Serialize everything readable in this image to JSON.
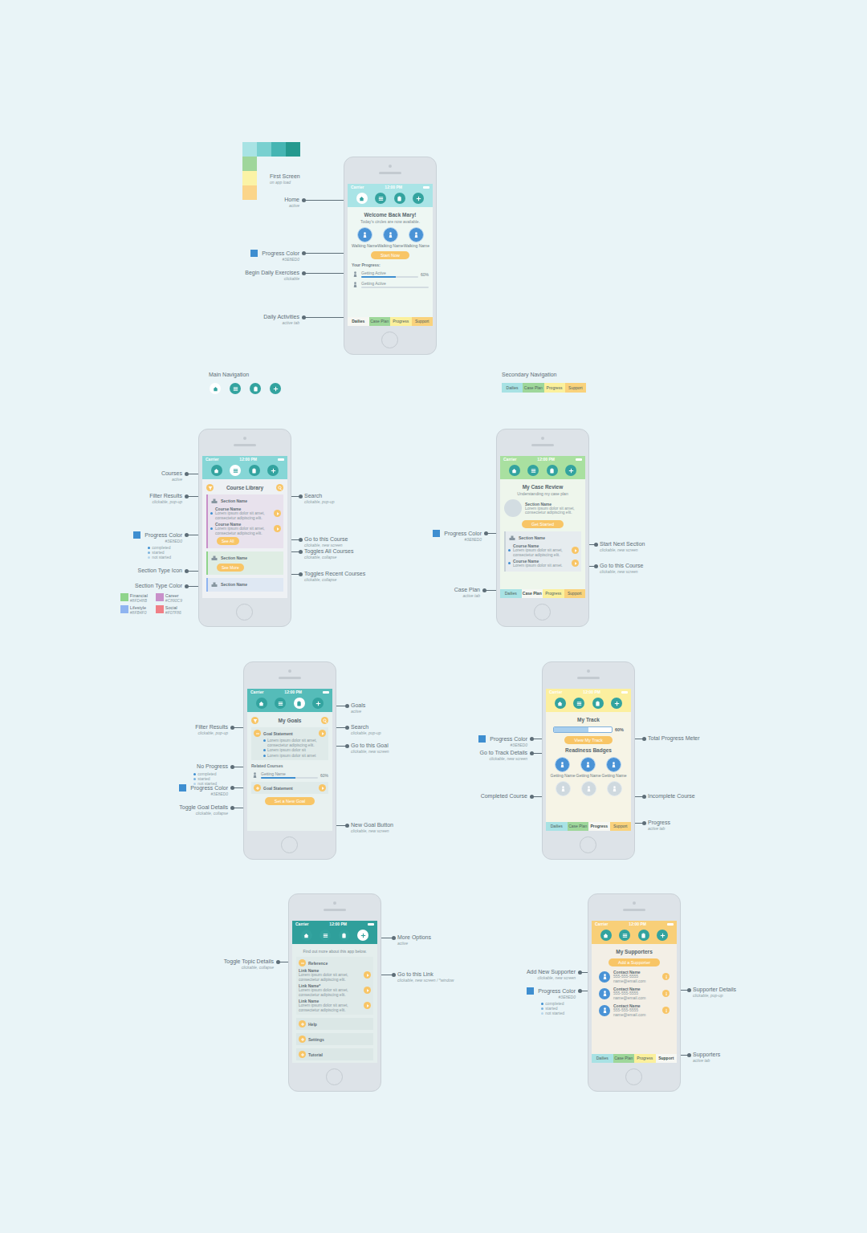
{
  "title": {
    "label": "First Screen",
    "note": "on app load"
  },
  "palette": [
    {
      "color": "#a8e3e4"
    },
    {
      "color": "#79d0d0"
    },
    {
      "color": "#46b5b3"
    },
    {
      "color": "#25998f"
    },
    {
      "color": "#9fd69b"
    },
    {
      "color": "#fbf3a6"
    },
    {
      "color": "#fbd58a"
    }
  ],
  "main_navigation": {
    "label": "Main Navigation",
    "items": [
      {
        "selected": true
      },
      {
        "selected": false
      },
      {
        "selected": false
      },
      {
        "selected": false
      }
    ]
  },
  "secondary_navigation": {
    "label": "Secondary Navigation",
    "tabs": [
      {
        "label": "Dailies",
        "color": "#a8e2e4"
      },
      {
        "label": "Case Plan",
        "color": "#9ed79a"
      },
      {
        "label": "Progress",
        "color": "#fbf09c"
      },
      {
        "label": "Support",
        "color": "#f9d27c"
      }
    ]
  },
  "phones": [
    {
      "status": {
        "carrier": "Carrier",
        "time": "12:00 PM"
      },
      "nav": [
        {
          "selected": true
        },
        {
          "selected": false
        },
        {
          "selected": false
        },
        {
          "selected": false
        }
      ],
      "blocks": [
        {
          "kind": "title",
          "text": "Welcome Back Mary!"
        },
        {
          "kind": "subtitle",
          "text": "Today's circles are now available."
        },
        {
          "kind": "circles",
          "items": [
            {
              "label": "Walking Name",
              "completed": true
            },
            {
              "label": "Walking Name",
              "completed": true
            },
            {
              "label": "Walking Name",
              "completed": true
            }
          ]
        },
        {
          "kind": "button",
          "text": "Start Now"
        },
        {
          "kind": "label",
          "text": "Your Progress:"
        },
        {
          "kind": "progress",
          "name": "Getting Active",
          "level": 0.6,
          "reading": "60%"
        },
        {
          "kind": "progress",
          "name": "Getting Active",
          "level": 0
        }
      ],
      "tabs": [
        {
          "label": "Dailies",
          "selected": true,
          "color": "#a8e2e4"
        },
        {
          "label": "Case Plan",
          "selected": false,
          "color": "#9ed79a"
        },
        {
          "label": "Progress",
          "selected": false,
          "color": "#fbf09c"
        },
        {
          "label": "Support",
          "selected": false,
          "color": "#f9d27c"
        }
      ],
      "annotations": [
        {
          "label": "Home",
          "note": "active"
        },
        {
          "label": "Progress Color",
          "note": "#3E8ED0",
          "swatch": "#3e8ed0"
        },
        {
          "label": "Begin Daily Exercises",
          "note": "clickable"
        },
        {
          "label": "Daily Activities",
          "note": "active tab"
        }
      ]
    },
    {
      "status": {
        "carrier": "Carrier",
        "time": "12:00 PM"
      },
      "nav": [
        {
          "selected": false
        },
        {
          "selected": true
        },
        {
          "selected": false
        },
        {
          "selected": false
        }
      ],
      "blocks": [
        {
          "kind": "toolbar",
          "title": "Course Library"
        },
        {
          "kind": "section",
          "name": "Section Name",
          "color": "#c890c9",
          "items": [
            {
              "name": "Course Name",
              "text": "Lorem ipsum dolor sit amet, consectetur adipiscing elit."
            },
            {
              "name": "Course Name",
              "text": "Lorem ipsum dolor sit amet, consectetur adipiscing elit."
            }
          ],
          "button": "See All"
        },
        {
          "kind": "section",
          "name": "Section Name",
          "color": "#8fd48b",
          "items": [],
          "button": "See More"
        },
        {
          "kind": "section",
          "name": "Section Name",
          "color": "#8fb4f0",
          "items": []
        }
      ],
      "annotations": [
        {
          "label": "Courses",
          "note": "active"
        },
        {
          "label": "Filter Results",
          "note": "clickable, pop-up"
        },
        {
          "label": "Progress Color",
          "note": "#3E8ED0",
          "swatch": "#3e8ed0",
          "bullets": [
            "completed",
            "started",
            "not started"
          ]
        },
        {
          "label": "Section Type Icon"
        },
        {
          "label": "Section Type Color",
          "legend": [
            {
              "label": "Financial",
              "note": "#8FD48B",
              "color": "#8fd48b"
            },
            {
              "label": "Career",
              "note": "#C890C9",
              "color": "#c890c9"
            },
            {
              "label": "Lifestyle",
              "note": "#8FB4F0",
              "color": "#8fb4f0"
            },
            {
              "label": "Social",
              "note": "#F07F86",
              "color": "#f07f86"
            }
          ]
        },
        {
          "label": "Search",
          "note": "clickable, pop-up"
        },
        {
          "label": "Go to this Course",
          "note": "clickable, new screen"
        },
        {
          "label": "Toggles All Courses",
          "note": "clickable, collapse"
        },
        {
          "label": "Toggles Recent Courses",
          "note": "clickable, collapse"
        }
      ]
    },
    {
      "status": {
        "carrier": "Carrier",
        "time": "12:00 PM"
      },
      "nav": [
        {
          "selected": false
        },
        {
          "selected": false
        },
        {
          "selected": false
        },
        {
          "selected": false
        }
      ],
      "blocks": [
        {
          "kind": "title",
          "text": "My Case Review"
        },
        {
          "kind": "subtitle",
          "text": "Understanding my case plan"
        },
        {
          "kind": "feature",
          "name": "Section Name",
          "text": "Lorem ipsum dolor sit amet, consectetur adipiscing elit."
        },
        {
          "kind": "button",
          "text": "Get Started"
        },
        {
          "kind": "section",
          "name": "Section Name",
          "items": [
            {
              "name": "Course Name",
              "text": "Lorem ipsum dolor sit amet, consectetur adipiscing elit."
            },
            {
              "name": "Course Name",
              "text": "Lorem ipsum dolor sit amet."
            }
          ]
        }
      ],
      "tabs": [
        {
          "label": "Dailies",
          "selected": false,
          "color": "#a8e2e4"
        },
        {
          "label": "Case Plan",
          "selected": true,
          "color": "#9ed79a"
        },
        {
          "label": "Progress",
          "selected": false,
          "color": "#fbf09c"
        },
        {
          "label": "Support",
          "selected": false,
          "color": "#f9d27c"
        }
      ],
      "annotations": [
        {
          "label": "Progress Color",
          "note": "#3E8ED0",
          "swatch": "#3e8ed0"
        },
        {
          "label": "Case Plan",
          "note": "active tab"
        },
        {
          "label": "Start Next Section",
          "note": "clickable, new screen"
        },
        {
          "label": "Go to this Course",
          "note": "clickable, new screen"
        }
      ]
    },
    {
      "status": {
        "carrier": "Carrier",
        "time": "12:00 PM"
      },
      "nav": [
        {
          "selected": false
        },
        {
          "selected": false
        },
        {
          "selected": true
        },
        {
          "selected": false
        }
      ],
      "blocks": [
        {
          "kind": "toolbar",
          "title": "My Goals"
        },
        {
          "kind": "goal",
          "name": "Goal Statement",
          "expanded": true,
          "bullets": [
            "Lorem ipsum dolor sit amet, consectetur adipiscing elit.",
            "Lorem ipsum dolor sit",
            "Lorem ipsum dolor sit amet"
          ]
        },
        {
          "kind": "label",
          "text": "Related Courses"
        },
        {
          "kind": "progress",
          "name": "Getting Name",
          "level": 0.6,
          "reading": "60%"
        },
        {
          "kind": "goal",
          "name": "Goal Statement",
          "expanded": false
        },
        {
          "kind": "button",
          "text": "Set a New Goal"
        }
      ],
      "annotations": [
        {
          "label": "Filter Results",
          "note": "clickable, pop-up"
        },
        {
          "label": "No Progress",
          "bullets": [
            "completed",
            "started",
            "not started"
          ]
        },
        {
          "label": "Progress Color",
          "note": "#3E8ED0",
          "swatch": "#3e8ed0"
        },
        {
          "label": "Toggle Goal Details",
          "note": "clickable, collapse"
        },
        {
          "label": "Goals",
          "note": "active"
        },
        {
          "label": "Search",
          "note": "clickable, pop-up"
        },
        {
          "label": "Go to this Goal",
          "note": "clickable, new screen"
        },
        {
          "label": "New Goal Button",
          "note": "clickable, new screen"
        }
      ]
    },
    {
      "status": {
        "carrier": "Carrier",
        "time": "12:00 PM"
      },
      "nav": [
        {
          "selected": false
        },
        {
          "selected": false
        },
        {
          "selected": false
        },
        {
          "selected": false
        }
      ],
      "blocks": [
        {
          "kind": "title",
          "text": "My Track"
        },
        {
          "kind": "meter",
          "level": 0.6,
          "reading": "60%"
        },
        {
          "kind": "button",
          "text": "View My Track"
        },
        {
          "kind": "title",
          "text": "Readiness Badges"
        },
        {
          "kind": "circles",
          "items": [
            {
              "label": "Getting Name",
              "completed": true
            },
            {
              "label": "Getting Name",
              "completed": true
            },
            {
              "label": "Getting Name",
              "completed": true
            }
          ]
        },
        {
          "kind": "circles",
          "items": [
            {
              "completed": false
            },
            {
              "completed": false
            },
            {
              "completed": false
            }
          ]
        }
      ],
      "tabs": [
        {
          "label": "Dailies",
          "selected": false,
          "color": "#a8e2e4"
        },
        {
          "label": "Case Plan",
          "selected": false,
          "color": "#9ed79a"
        },
        {
          "label": "Progress",
          "selected": true,
          "color": "#fbf09c"
        },
        {
          "label": "Support",
          "selected": false,
          "color": "#f9d27c"
        }
      ],
      "annotations": [
        {
          "label": "Progress Color",
          "note": "#3E8ED0",
          "swatch": "#3e8ed0"
        },
        {
          "label": "Go to Track Details",
          "note": "clickable, new screen"
        },
        {
          "label": "Completed Course"
        },
        {
          "label": "Total Progress Meter"
        },
        {
          "label": "Incomplete Course"
        },
        {
          "label": "Progress",
          "note": "active tab"
        }
      ]
    },
    {
      "status": {
        "carrier": "Carrier",
        "time": "12:00 PM"
      },
      "nav": [
        {
          "selected": false
        },
        {
          "selected": false
        },
        {
          "selected": false
        },
        {
          "selected": true
        }
      ],
      "blocks": [
        {
          "kind": "note",
          "text": "Find out more about this app below."
        },
        {
          "kind": "links",
          "name": "Reference",
          "items": [
            {
              "name": "Link Name",
              "text": "Lorem ipsum dolor sit amet, consectetur adipiscing elit."
            },
            {
              "name": "Link Name*",
              "text": "Lorem ipsum dolor sit amet, consectetur adipiscing elit."
            },
            {
              "name": "Link Name",
              "text": "Lorem ipsum dolor sit amet, consectetur adipiscing elit."
            }
          ]
        },
        {
          "kind": "menu",
          "text": "Help"
        },
        {
          "kind": "menu",
          "text": "Settings"
        },
        {
          "kind": "menu",
          "text": "Tutorial"
        }
      ],
      "annotations": [
        {
          "label": "Toggle Topic Details",
          "note": "clickable, collapse"
        },
        {
          "label": "More Options",
          "note": "active"
        },
        {
          "label": "Go to this Link",
          "note": "clickable, new screen / *window"
        }
      ]
    },
    {
      "status": {
        "carrier": "Carrier",
        "time": "12:00 PM"
      },
      "nav": [
        {
          "selected": false
        },
        {
          "selected": false
        },
        {
          "selected": false
        },
        {
          "selected": false
        }
      ],
      "blocks": [
        {
          "kind": "title",
          "text": "My Supporters"
        },
        {
          "kind": "button",
          "text": "Add a Supporter"
        },
        {
          "kind": "contact",
          "name": "Contact Name",
          "phone": "555-555-5555",
          "email": "name@email.com"
        },
        {
          "kind": "contact",
          "name": "Contact Name",
          "phone": "555-555-5555",
          "email": "name@email.com"
        },
        {
          "kind": "contact",
          "name": "Contact Name",
          "phone": "555-555-5555",
          "email": "name@email.com"
        }
      ],
      "tabs": [
        {
          "label": "Dailies",
          "selected": false,
          "color": "#a8e2e4"
        },
        {
          "label": "Case Plan",
          "selected": false,
          "color": "#9ed79a"
        },
        {
          "label": "Progress",
          "selected": false,
          "color": "#fbf09c"
        },
        {
          "label": "Support",
          "selected": true,
          "color": "#f9d27c"
        }
      ],
      "annotations": [
        {
          "label": "Add New Supporter",
          "note": "clickable, new screen"
        },
        {
          "label": "Progress Color",
          "note": "#3E8ED0",
          "swatch": "#3e8ed0",
          "bullets": [
            "completed",
            "started",
            "not started"
          ]
        },
        {
          "label": "Supporter Details",
          "note": "clickable, pop-up"
        },
        {
          "label": "Supporters",
          "note": "active tab"
        }
      ]
    }
  ]
}
